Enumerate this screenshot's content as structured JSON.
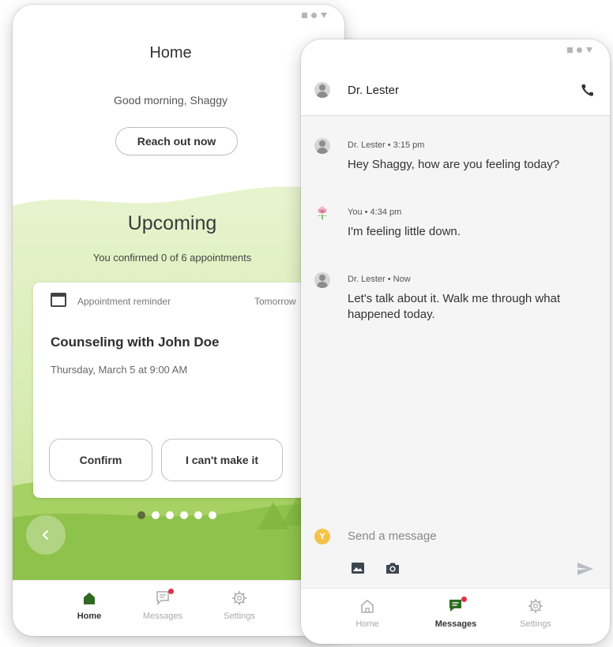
{
  "home_screen": {
    "title": "Home",
    "greeting": "Good morning, Shaggy",
    "reach_out_label": "Reach out now",
    "upcoming": {
      "title": "Upcoming",
      "subtitle": "You confirmed 0 of 6 appointments",
      "card": {
        "label": "Appointment reminder",
        "when": "Tomorrow",
        "title": "Counseling with John Doe",
        "date": "Thursday, March 5 at 9:00 AM",
        "confirm_label": "Confirm",
        "decline_label": "I can't make it"
      },
      "pagination": {
        "total": 6,
        "active_index": 0
      }
    },
    "nav": [
      {
        "label": "Home",
        "icon": "home-icon",
        "active": true
      },
      {
        "label": "Messages",
        "icon": "messages-icon",
        "badge": true
      },
      {
        "label": "Settings",
        "icon": "settings-icon"
      }
    ]
  },
  "messages_screen": {
    "contact_name": "Dr. Lester",
    "messages": [
      {
        "sender": "Dr. Lester",
        "meta": "Dr. Lester • 3:15 pm",
        "text": "Hey Shaggy, how are you feeling today?"
      },
      {
        "sender": "You",
        "meta": "You • 4:34 pm",
        "text": "I'm feeling little down."
      },
      {
        "sender": "Dr. Lester",
        "meta": "Dr. Lester • Now",
        "text": "Let's talk about it. Walk me through what happened today."
      }
    ],
    "composer": {
      "avatar_initial": "Y",
      "placeholder": "Send a message"
    },
    "nav": [
      {
        "label": "Home",
        "icon": "home-icon"
      },
      {
        "label": "Messages",
        "icon": "messages-icon",
        "active": true,
        "badge": true
      },
      {
        "label": "Settings",
        "icon": "settings-icon"
      }
    ]
  },
  "colors": {
    "green_light": "#dbefb9",
    "green_dark": "#8ec24b",
    "nav_active": "#2f6a22",
    "badge": "#e2304b",
    "avatar_you": "#f4c34a"
  }
}
